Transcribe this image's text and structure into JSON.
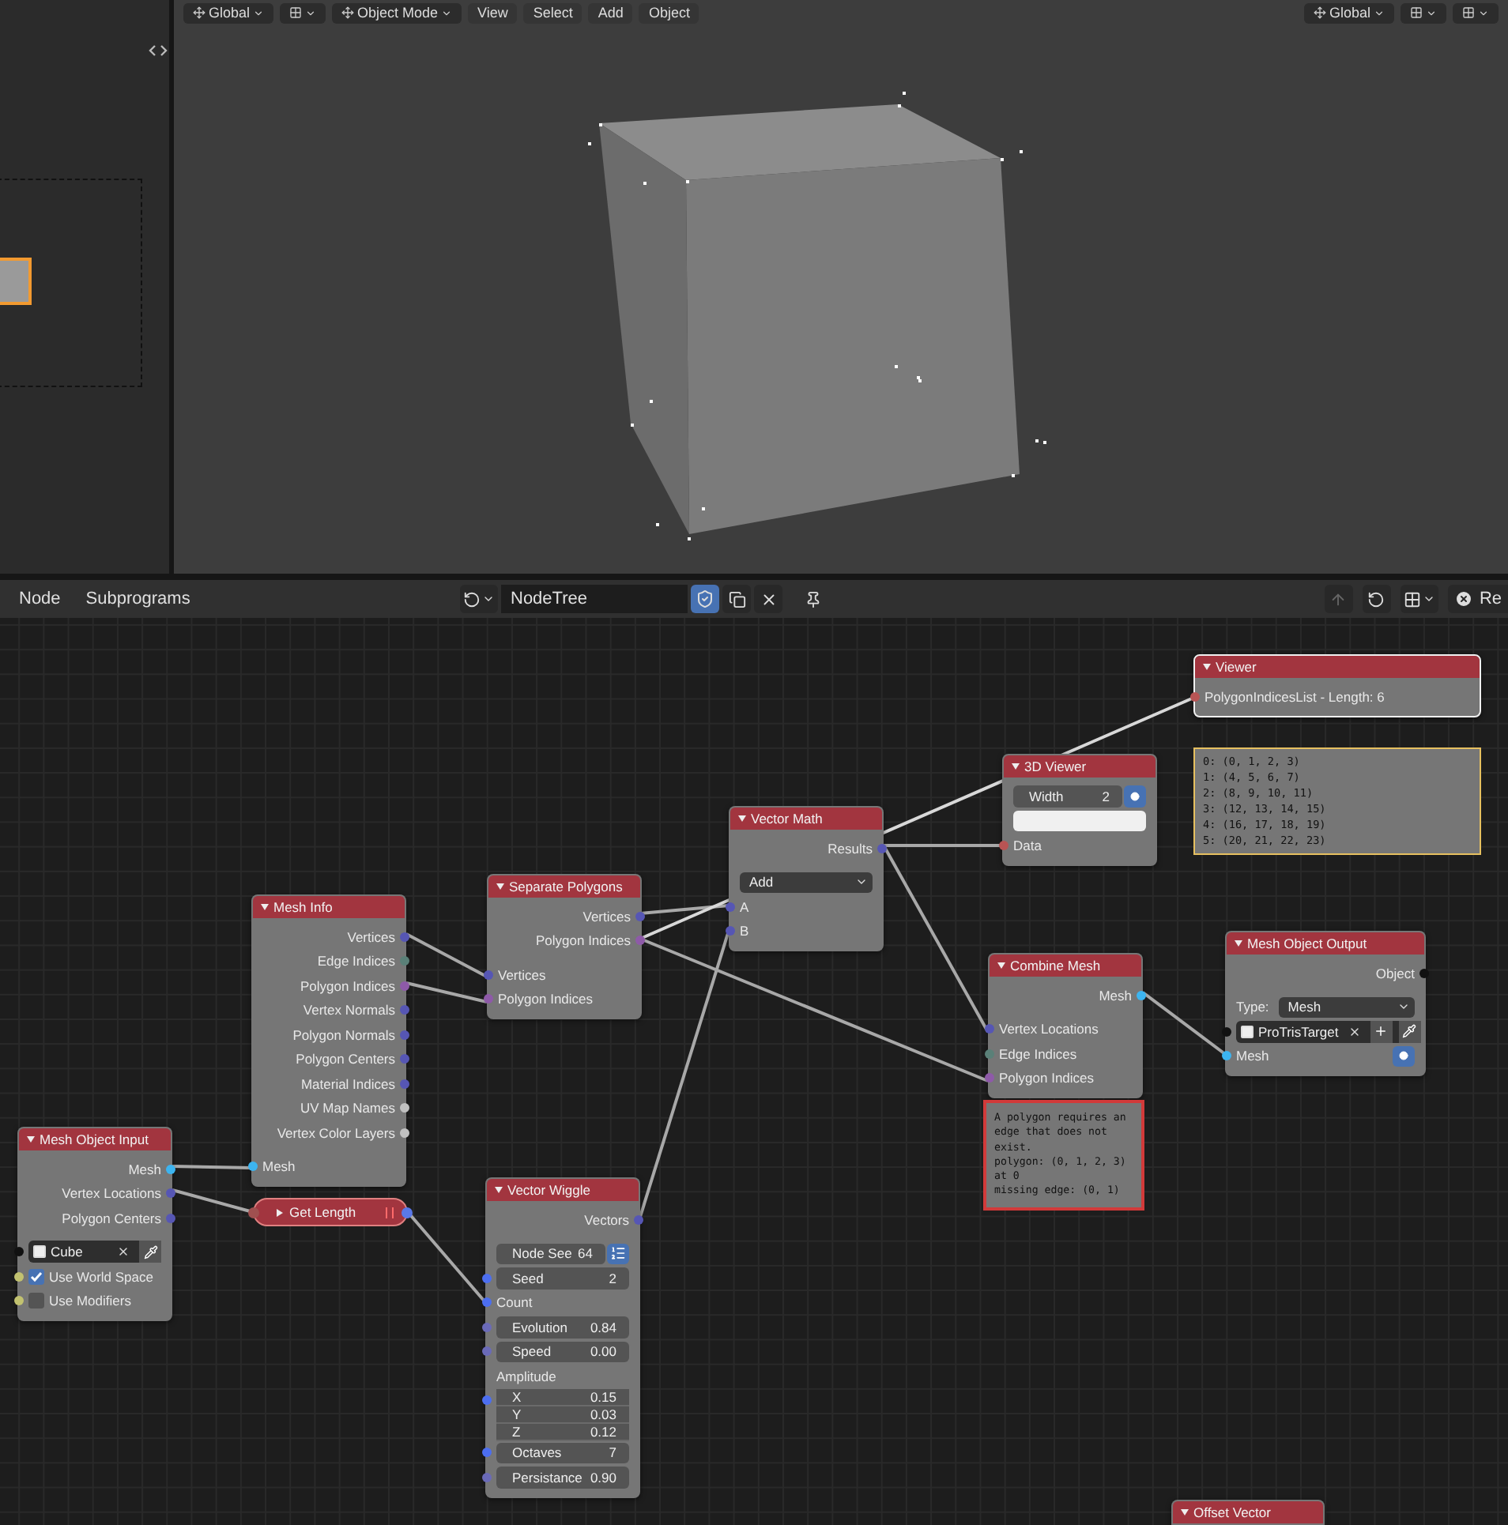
{
  "viewport": {
    "header_left": [
      {
        "kind": "dropdown",
        "label": "Global"
      },
      {
        "kind": "icon_dropdown"
      },
      {
        "kind": "dropdown",
        "label": "Object Mode"
      },
      {
        "kind": "menu",
        "label": "View"
      },
      {
        "kind": "menu",
        "label": "Select"
      },
      {
        "kind": "menu",
        "label": "Add"
      },
      {
        "kind": "menu",
        "label": "Object"
      }
    ],
    "header_right": [
      {
        "kind": "dropdown",
        "label": "Global"
      },
      {
        "kind": "icon_dropdown"
      },
      {
        "kind": "icon_dropdown"
      }
    ]
  },
  "node_editor": {
    "menus": [
      "Node",
      "Subprograms"
    ],
    "tree_name": "NodeTree",
    "protected": true,
    "right_button": "Re"
  },
  "nodes": [
    {
      "title": "Viewer",
      "selected": true,
      "rows": [
        {
          "kind": "input",
          "label": "PolygonIndicesList - Length: 6",
          "color": "#b85454"
        }
      ],
      "output_lines": [
        "0: (0, 1, 2, 3)",
        "1: (4, 5, 6, 7)",
        "2: (8, 9, 10, 11)",
        "3: (12, 13, 14, 15)",
        "4: (16, 17, 18, 19)",
        "5: (20, 21, 22, 23)"
      ]
    },
    {
      "title": "3D Viewer",
      "selected": false,
      "rows": [
        {
          "kind": "field",
          "label": "Width",
          "value": "2",
          "toggle": true
        },
        {
          "kind": "empty_field"
        },
        {
          "kind": "input",
          "label": "Data",
          "color": "#b85454"
        }
      ]
    },
    {
      "title": "Vector Math",
      "selected": false,
      "rows": [
        {
          "kind": "output",
          "label": "Results",
          "color": "#5656b4"
        },
        {
          "kind": "dropdown",
          "value": "Add"
        },
        {
          "kind": "input",
          "label": "A",
          "color": "#5656b4"
        },
        {
          "kind": "input",
          "label": "B",
          "color": "#5656b4"
        }
      ]
    },
    {
      "title": "Separate Polygons",
      "selected": false,
      "rows": [
        {
          "kind": "output",
          "label": "Vertices",
          "color": "#5656b4"
        },
        {
          "kind": "output",
          "label": "Polygon Indices",
          "color": "#8e5aa8"
        },
        {
          "kind": "input",
          "label": "Vertices",
          "color": "#5656b4"
        },
        {
          "kind": "input",
          "label": "Polygon Indices",
          "color": "#8e5aa8"
        }
      ]
    },
    {
      "title": "Mesh Info",
      "selected": false,
      "rows": [
        {
          "kind": "output",
          "label": "Vertices",
          "color": "#5656b4"
        },
        {
          "kind": "output",
          "label": "Edge Indices",
          "color": "#5a8078"
        },
        {
          "kind": "output",
          "label": "Polygon Indices",
          "color": "#8e5aa8"
        },
        {
          "kind": "output",
          "label": "Vertex Normals",
          "color": "#5656b4"
        },
        {
          "kind": "output",
          "label": "Polygon Normals",
          "color": "#5656b4"
        },
        {
          "kind": "output",
          "label": "Polygon Centers",
          "color": "#5656b4"
        },
        {
          "kind": "output",
          "label": "Material Indices",
          "color": "#5656b4"
        },
        {
          "kind": "output",
          "label": "UV Map Names",
          "color": "#c0c0c0"
        },
        {
          "kind": "output",
          "label": "Vertex Color Layers",
          "color": "#c0c0c0"
        },
        {
          "kind": "input",
          "label": "Mesh",
          "color": "#3cb4f0"
        }
      ]
    },
    {
      "title": "Combine Mesh",
      "selected": false,
      "rows": [
        {
          "kind": "output",
          "label": "Mesh",
          "color": "#3cb4f0"
        },
        {
          "kind": "input",
          "label": "Vertex Locations",
          "color": "#5656b4"
        },
        {
          "kind": "input",
          "label": "Edge Indices",
          "color": "#5a8078"
        },
        {
          "kind": "input",
          "label": "Polygon Indices",
          "color": "#8e5aa8"
        }
      ],
      "error": "A polygon requires an\nedge that does not\nexist.\npolygon: (0, 1, 2, 3)\nat 0\nmissing edge: (0, 1)"
    },
    {
      "title": "Mesh Object Output",
      "selected": false,
      "rows": [
        {
          "kind": "output",
          "label": "Object",
          "color": "#111111"
        },
        {
          "kind": "enum",
          "label": "Type:",
          "value": "Mesh"
        },
        {
          "kind": "object",
          "value": "ProTrisTarget",
          "color": "#111111",
          "plus_button": true
        },
        {
          "kind": "input",
          "label": "Mesh",
          "color": "#3cb4f0",
          "toggle": true
        }
      ]
    },
    {
      "title": "Mesh Object Input",
      "selected": false,
      "rows": [
        {
          "kind": "output",
          "label": "Mesh",
          "color": "#3cb4f0"
        },
        {
          "kind": "output",
          "label": "Vertex Locations",
          "color": "#5656b4"
        },
        {
          "kind": "output",
          "label": "Polygon Centers",
          "color": "#5656b4"
        },
        {
          "kind": "object",
          "value": "Cube",
          "color": "#111111"
        },
        {
          "kind": "checkbox",
          "label": "Use World Space",
          "checked": true,
          "color": "#c2c270"
        },
        {
          "kind": "checkbox",
          "label": "Use Modifiers",
          "checked": false,
          "color": "#c2c270"
        }
      ]
    },
    {
      "title": "Get Length",
      "selected": false,
      "collapsed": true,
      "sockets": [
        {
          "kind": "input",
          "color": "#a05050"
        },
        {
          "kind": "output",
          "color": "#5a78e8"
        }
      ]
    },
    {
      "title": "Vector Wiggle",
      "selected": false,
      "rows": [
        {
          "kind": "output",
          "label": "Vectors",
          "color": "#5656b4"
        },
        {
          "kind": "field",
          "label": "Node See",
          "value": "64",
          "list_button": true
        },
        {
          "kind": "field",
          "label": "Seed",
          "value": "2",
          "color": "#4c6ef0"
        },
        {
          "kind": "label",
          "label": "Count",
          "color": "#4c6ef0"
        },
        {
          "kind": "field",
          "label": "Evolution",
          "value": "0.84",
          "color": "#6a6ab8"
        },
        {
          "kind": "field",
          "label": "Speed",
          "value": "0.00",
          "color": "#6a6ab8"
        },
        {
          "kind": "label",
          "label": "Amplitude"
        },
        {
          "kind": "vector",
          "color": "#4c6ef0",
          "items": [
            {
              "label": "X",
              "value": "0.15"
            },
            {
              "label": "Y",
              "value": "0.03"
            },
            {
              "label": "Z",
              "value": "0.12"
            }
          ]
        },
        {
          "kind": "field",
          "label": "Octaves",
          "value": "7",
          "color": "#4c6ef0"
        },
        {
          "kind": "field",
          "label": "Persistance",
          "value": "0.90",
          "color": "#6a6ab8"
        }
      ]
    },
    {
      "title": "Offset Vector",
      "selected": false
    }
  ]
}
